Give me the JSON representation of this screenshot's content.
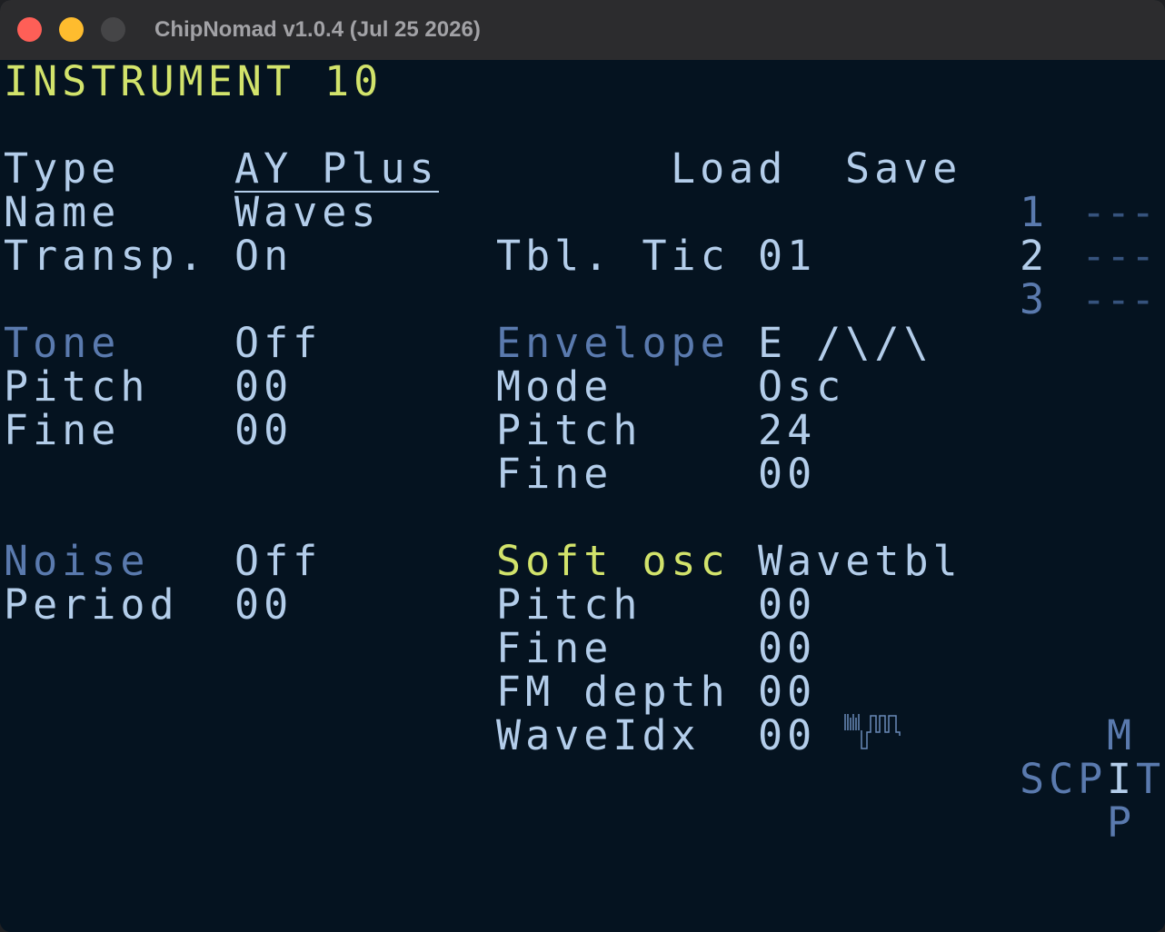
{
  "window": {
    "title": "ChipNomad v1.0.4 (Jul 25 2026)"
  },
  "header": {
    "title": "INSTRUMENT 10"
  },
  "actions": {
    "load": "Load",
    "save": "Save"
  },
  "general": {
    "type_label": "Type",
    "type_value": "AY Plus",
    "name_label": "Name",
    "name_value": "Waves",
    "transp_label": "Transp.",
    "transp_value": "On",
    "tbl_tic_label": "Tbl. Tic",
    "tbl_tic_value": "01"
  },
  "tone": {
    "label": "Tone",
    "value": "Off",
    "pitch_label": "Pitch",
    "pitch_value": "00",
    "fine_label": "Fine",
    "fine_value": "00"
  },
  "noise": {
    "label": "Noise",
    "value": "Off",
    "period_label": "Period",
    "period_value": "00"
  },
  "envelope": {
    "label": "Envelope",
    "value": "E /\\/\\",
    "mode_label": "Mode",
    "mode_value": "Osc",
    "pitch_label": "Pitch",
    "pitch_value": "24",
    "fine_label": "Fine",
    "fine_value": "00"
  },
  "soft_osc": {
    "label": "Soft osc",
    "value": "Wavetbl",
    "pitch_label": "Pitch",
    "pitch_value": "00",
    "fine_label": "Fine",
    "fine_value": "00",
    "fm_label": "FM depth",
    "fm_value": "00",
    "waveidx_label": "WaveIdx",
    "waveidx_value": "00"
  },
  "channels": [
    {
      "num": "1",
      "value": "---"
    },
    {
      "num": "2",
      "value": "---"
    },
    {
      "num": "3",
      "value": "---"
    }
  ],
  "screen_map": {
    "m": "M",
    "scp": "SCP",
    "i": "I",
    "t": "T",
    "p": "P"
  },
  "colors": {
    "background": "#051320",
    "text": "#b3cdea",
    "highlight": "#d2e36b",
    "dim": "#5a7aae"
  }
}
